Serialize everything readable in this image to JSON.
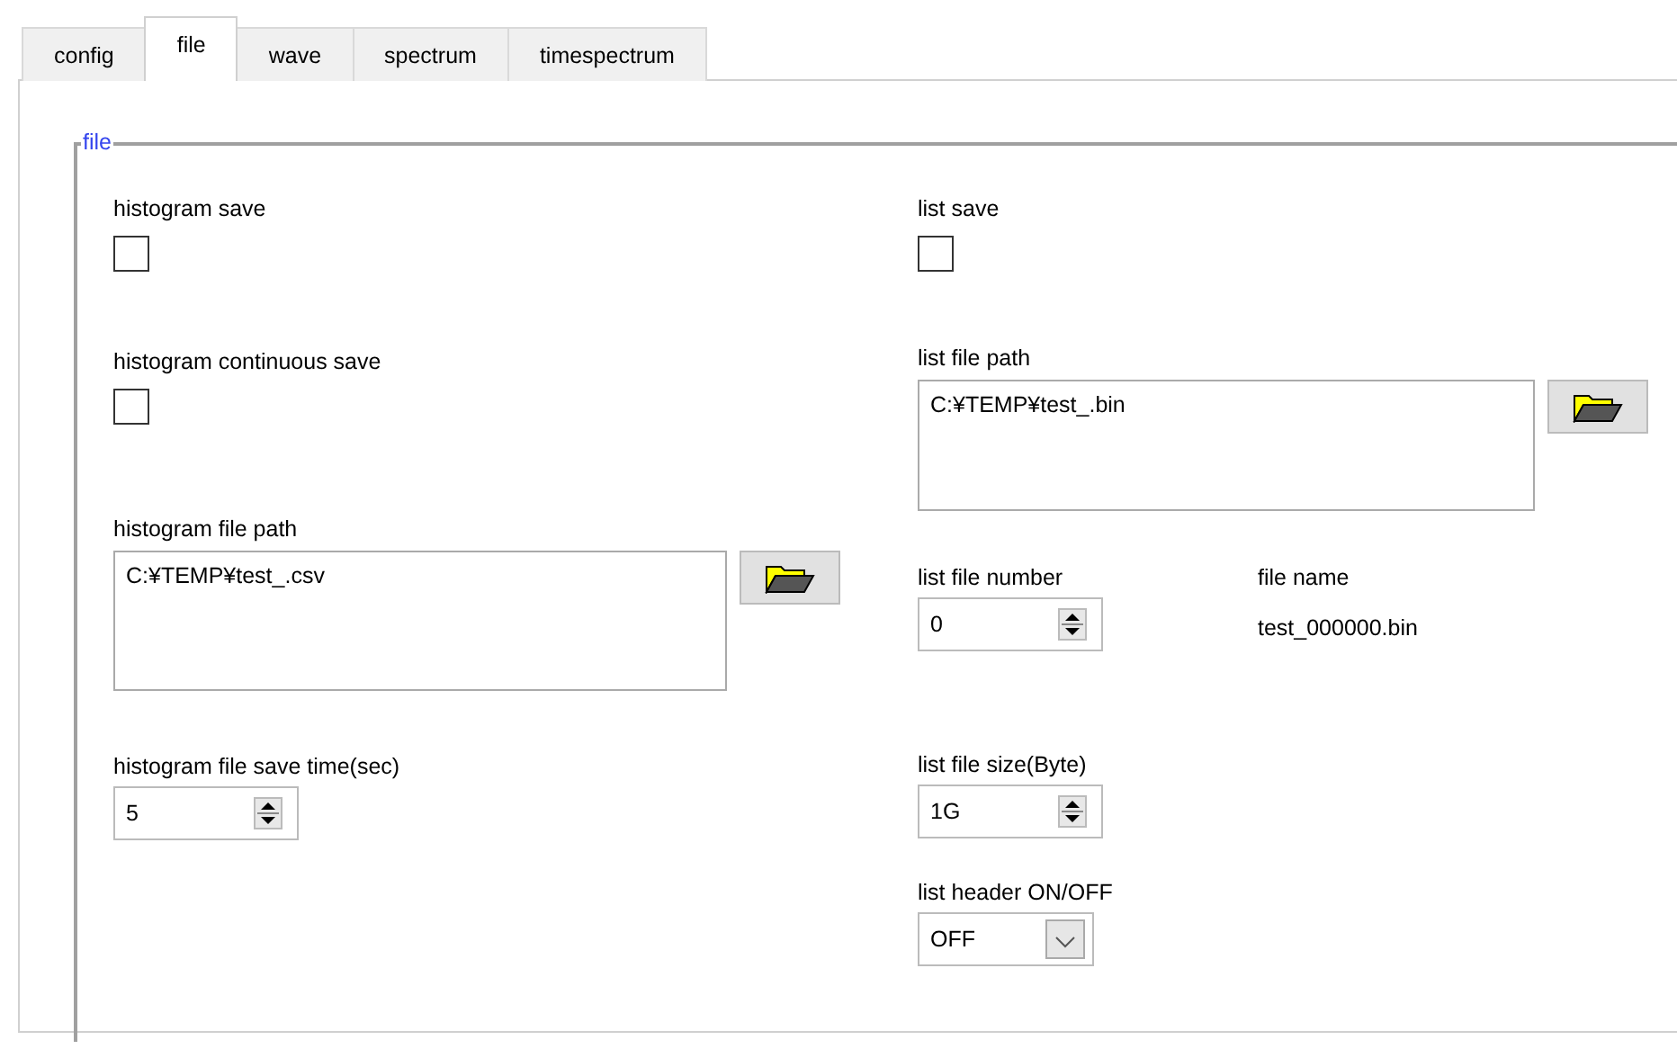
{
  "tabs": [
    {
      "label": "config",
      "selected": false
    },
    {
      "label": "file",
      "selected": true
    },
    {
      "label": "wave",
      "selected": false
    },
    {
      "label": "spectrum",
      "selected": false
    },
    {
      "label": "timespectrum",
      "selected": false
    }
  ],
  "group": {
    "title": "file"
  },
  "columns": [
    [
      {
        "kind": "checkbox",
        "label": "histogram save",
        "checked": false
      },
      {
        "kind": "checkbox",
        "label": "histogram continuous save",
        "checked": false
      },
      {
        "kind": "path",
        "label": "histogram file path",
        "value": "C:¥TEMP¥test_.csv"
      },
      {
        "kind": "spinner",
        "label": "histogram file save time(sec)",
        "value": "5"
      }
    ],
    [
      {
        "kind": "checkbox",
        "label": "list save",
        "checked": false
      },
      {
        "kind": "path",
        "label": "list file path",
        "value": "C:¥TEMP¥test_.bin"
      },
      {
        "kind": "spinner",
        "label": "list file number",
        "value": "0",
        "readout": {
          "label": "file name",
          "value": "test_000000.bin"
        }
      },
      {
        "kind": "spinner",
        "label": "list file size(Byte)",
        "value": "1G"
      },
      {
        "kind": "dropdown",
        "label": "list header ON/OFF",
        "value": "OFF"
      }
    ]
  ]
}
